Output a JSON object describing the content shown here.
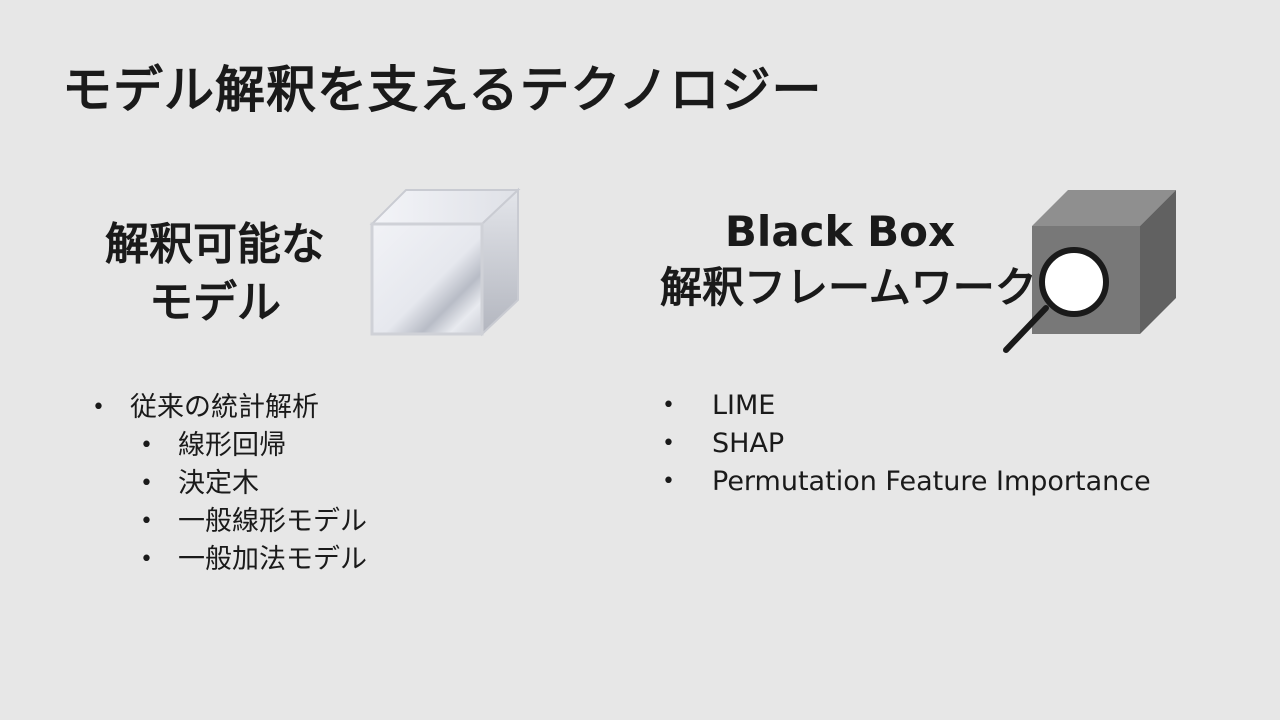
{
  "slide": {
    "title": "モデル解釈を支えるテクノロジー"
  },
  "left": {
    "heading_line1": "解釈可能な",
    "heading_line2": "モデル",
    "cube_icon": "transparent-cube-icon",
    "bullet": "•",
    "items": [
      {
        "level": 1,
        "text": "従来の統計解析"
      },
      {
        "level": 2,
        "text": "線形回帰"
      },
      {
        "level": 2,
        "text": "決定木"
      },
      {
        "level": 2,
        "text": "一般線形モデル"
      },
      {
        "level": 2,
        "text": "一般加法モデル"
      }
    ]
  },
  "right": {
    "heading_line1": "Black Box",
    "heading_line2": "解釈フレームワーク",
    "cube_icon": "black-box-magnifier-icon",
    "bullet": "•",
    "items": [
      {
        "text": "LIME"
      },
      {
        "text": "SHAP"
      },
      {
        "text": "Permutation Feature Importance"
      }
    ]
  },
  "colors": {
    "background": "#e7e7e7",
    "text": "#1a1a1a",
    "black_box_front": "#787878",
    "black_box_top": "#8f8f8f",
    "black_box_side": "#616161"
  }
}
